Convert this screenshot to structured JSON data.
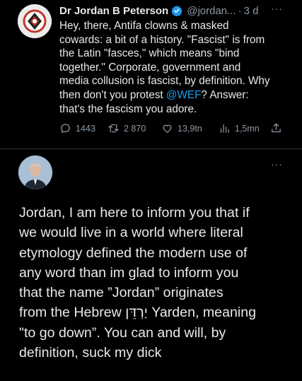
{
  "tweet": {
    "display_name": "Dr Jordan B Peterson",
    "handle": "@jordan...",
    "separator": "·",
    "time": "3 d",
    "more": "···",
    "text_before_mention": "Hey, there, Antifa clowns & masked\ncowards: a bit of a history. \"Fascist\" is from\nthe Latin \"fasces,\" which means \"bind\ntogether.\" Corporate, government and\nmedia collusion is fascist, by definition. Why\nthen don't you protest ",
    "mention": "@WEF",
    "text_after_mention": "? Answer:\nthat's the fascism you adore.",
    "replies": "1443",
    "retweets": "2 870",
    "likes": "13,9tn",
    "views": "1,5mn",
    "icons": [
      "verified-badge-icon",
      "reply-icon",
      "retweet-icon",
      "like-icon",
      "views-icon",
      "share-icon"
    ],
    "colors": {
      "accent": "#1d9bf0",
      "muted": "#8b98a5",
      "background": "#000000"
    }
  },
  "reply": {
    "more": "···",
    "text": "Jordan, I am here to inform you that if\nwe would live in a world where literal\netymology defined the modern use of\nany word than im glad to inform you\nthat the name ”Jordan” originates\nfrom the Hebrew יַרְדֵּן Yarden, meaning\n\"to go down”. You can and will, by\ndefinition, suck my dick"
  }
}
